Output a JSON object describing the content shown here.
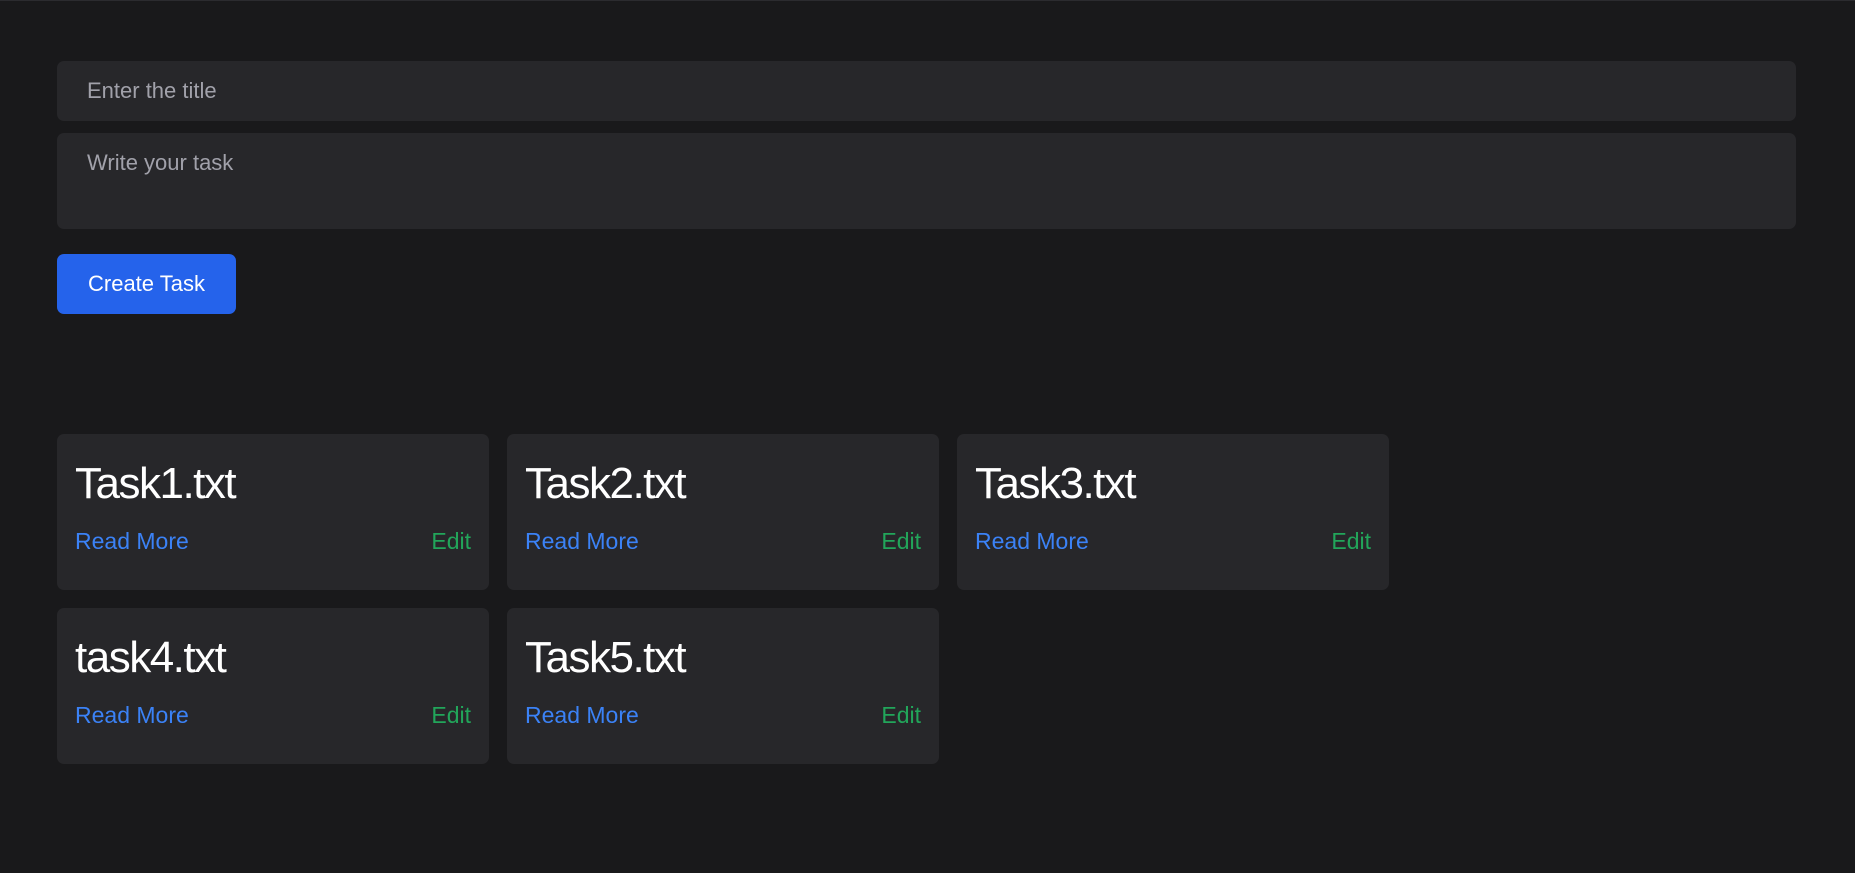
{
  "form": {
    "title_placeholder": "Enter the title",
    "task_placeholder": "Write your task",
    "create_label": "Create Task"
  },
  "tasks": [
    {
      "title": "Task1.txt",
      "read_more": "Read More",
      "edit": "Edit"
    },
    {
      "title": "Task2.txt",
      "read_more": "Read More",
      "edit": "Edit"
    },
    {
      "title": "Task3.txt",
      "read_more": "Read More",
      "edit": "Edit"
    },
    {
      "title": "task4.txt",
      "read_more": "Read More",
      "edit": "Edit"
    },
    {
      "title": "Task5.txt",
      "read_more": "Read More",
      "edit": "Edit"
    }
  ],
  "colors": {
    "background": "#19191b",
    "surface": "#27272a",
    "primary": "#2563eb",
    "link": "#3b82f6",
    "edit": "#22a55a"
  }
}
